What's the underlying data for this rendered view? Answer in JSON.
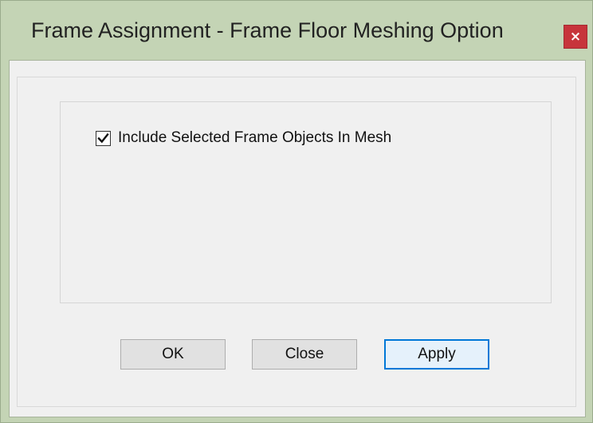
{
  "window": {
    "title": "Frame Assignment - Frame Floor Meshing Option",
    "close_glyph": "×"
  },
  "options": {
    "include_in_mesh": {
      "label": "Include Selected Frame Objects In Mesh",
      "checked": true
    }
  },
  "buttons": {
    "ok": "OK",
    "close": "Close",
    "apply": "Apply"
  },
  "icons": {
    "window_close": "close-icon",
    "checkbox_mark": "checkmark-icon"
  },
  "colors": {
    "titlebar_bg": "#c4d4b5",
    "close_button": "#c7343b",
    "default_button_border": "#0078d7"
  }
}
